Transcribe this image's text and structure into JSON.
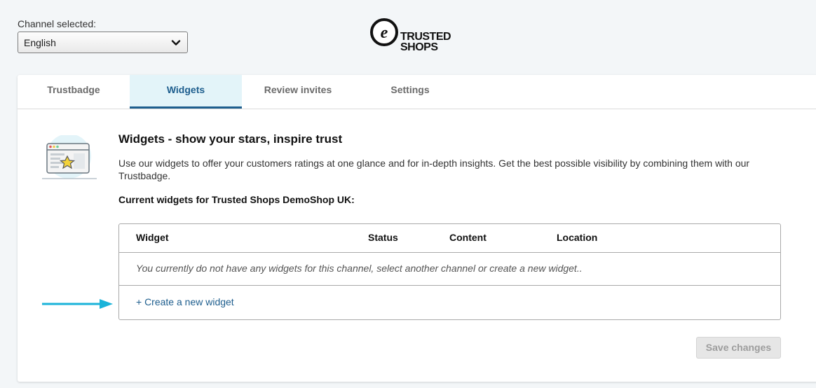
{
  "channel": {
    "label": "Channel selected:",
    "selected": "English"
  },
  "logo": {
    "line1": "TRUSTED",
    "line2": "SHOPS"
  },
  "tabs": [
    {
      "label": "Trustbadge",
      "active": false
    },
    {
      "label": "Widgets",
      "active": true
    },
    {
      "label": "Review invites",
      "active": false
    },
    {
      "label": "Settings",
      "active": false
    }
  ],
  "content": {
    "heading": "Widgets - show your stars, inspire trust",
    "intro": "Use our widgets to offer your customers ratings at one glance and for in-depth insights. Get the best possible visibility by combining them with our Trustbadge.",
    "current_label": "Current widgets for Trusted Shops DemoShop UK:"
  },
  "table": {
    "columns": [
      "Widget",
      "Status",
      "Content",
      "Location"
    ],
    "empty_message": "You currently do not have any widgets for this channel, select another channel or create a new widget..",
    "create_link": "+ Create a new widget"
  },
  "save_button": "Save changes",
  "colors": {
    "accent": "#1e5e8e",
    "active_tab_bg": "#e3f4f9",
    "arrow": "#1ab3d9"
  },
  "icons": {
    "dropdown": "chevron-down-icon",
    "illustration": "browser-window-star-icon",
    "pointer": "arrow-right-icon"
  }
}
